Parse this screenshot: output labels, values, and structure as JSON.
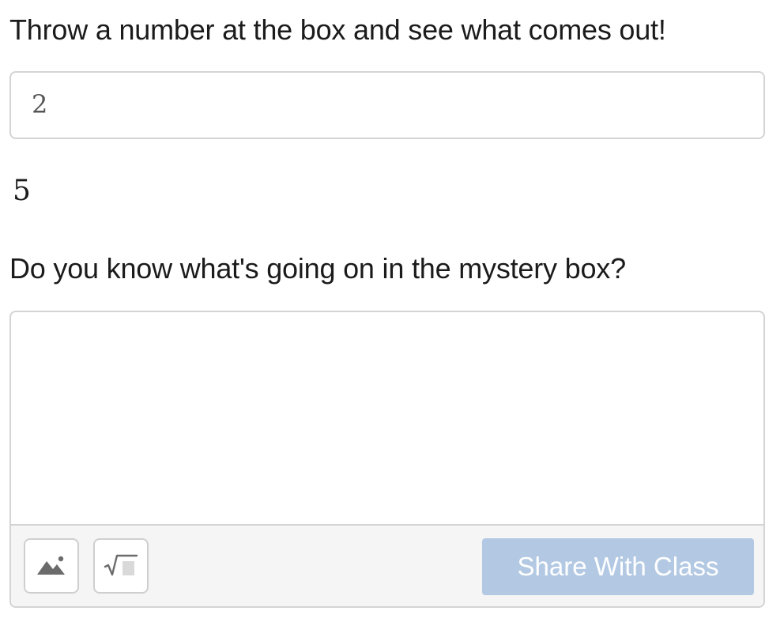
{
  "prompts": {
    "throw_number": "Throw a number at the box and see what comes out!",
    "mystery_question": "Do you know what's going on in the mystery box?"
  },
  "math_input": {
    "value": "2"
  },
  "output": {
    "value": "5"
  },
  "response": {
    "value": "",
    "toolbar": {
      "image_icon": "image-icon",
      "math_icon": "square-root-icon",
      "share_label": "Share With Class",
      "share_color": "#b3c9e3"
    }
  },
  "colors": {
    "text": "#1b1b1b",
    "border": "#d4d4d4",
    "toolbar_bg": "#f5f5f5",
    "icon": "#6b6b6b"
  }
}
